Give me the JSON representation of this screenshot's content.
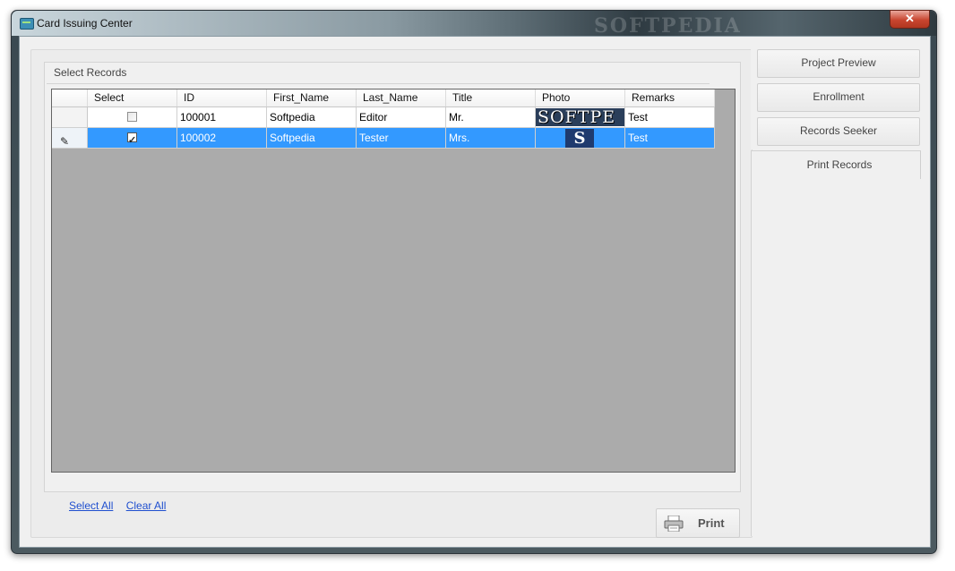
{
  "window": {
    "title": "Card Issuing Center",
    "close_glyph": "✕",
    "watermark": "SOFTPEDIA"
  },
  "group": {
    "title": "Select Records"
  },
  "grid": {
    "columns": [
      "Select",
      "ID",
      "First_Name",
      "Last_Name",
      "Title",
      "Photo",
      "Remarks"
    ],
    "rows": [
      {
        "select": false,
        "id": "100001",
        "first_name": "Softpedia",
        "last_name": "Editor",
        "title": "Mr.",
        "photo_text": "SOFTPE",
        "remarks": "Test"
      },
      {
        "select": true,
        "id": "100002",
        "first_name": "Softpedia",
        "last_name": "Tester",
        "title": "Mrs.",
        "photo_text": "S",
        "remarks": "Test"
      }
    ]
  },
  "links": {
    "select_all": "Select All",
    "clear_all": "Clear All"
  },
  "print_button": {
    "label": "Print",
    "icon": "printer-icon"
  },
  "side_menu": {
    "items": [
      "Project Preview",
      "Enrollment",
      "Records Seeker",
      "Print Records"
    ],
    "active": "Print Records"
  },
  "colors": {
    "selection": "#3399ff",
    "grid_bg": "#ababab"
  }
}
